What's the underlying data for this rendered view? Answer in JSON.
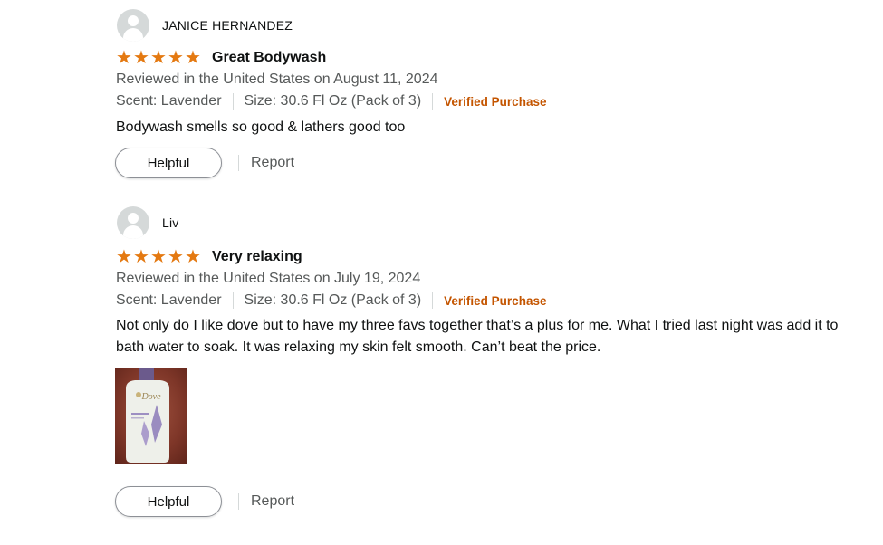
{
  "reviews": [
    {
      "profile_name": "JANICE HERNANDEZ",
      "rating": 5,
      "title": "Great Bodywash",
      "date": "Reviewed in the United States on August 11, 2024",
      "scent": "Scent: Lavender",
      "size": "Size: 30.6 Fl Oz (Pack of 3)",
      "verified": "Verified Purchase",
      "body": "Bodywash smells so good & lathers good too",
      "helpful_label": "Helpful",
      "report_label": "Report"
    },
    {
      "profile_name": "Liv",
      "rating": 5,
      "title": "Very relaxing",
      "date": "Reviewed in the United States on July 19, 2024",
      "scent": "Scent: Lavender",
      "size": "Size: 30.6 Fl Oz (Pack of 3)",
      "verified": "Verified Purchase",
      "body": "Not only do I like dove but to have my three favs together that’s a plus for me. What I tried last night was add it to bath water to soak. It was relaxing my skin felt smooth. Can’t beat the price.",
      "helpful_label": "Helpful",
      "report_label": "Report",
      "photo_brand": "Dove"
    }
  ],
  "colors": {
    "star": "#e47911",
    "verified": "#c45500",
    "secondary_text": "#565959",
    "avatar_bg": "#d5d9d9"
  },
  "icons": {
    "star": "star-icon",
    "avatar": "default-avatar-icon"
  }
}
